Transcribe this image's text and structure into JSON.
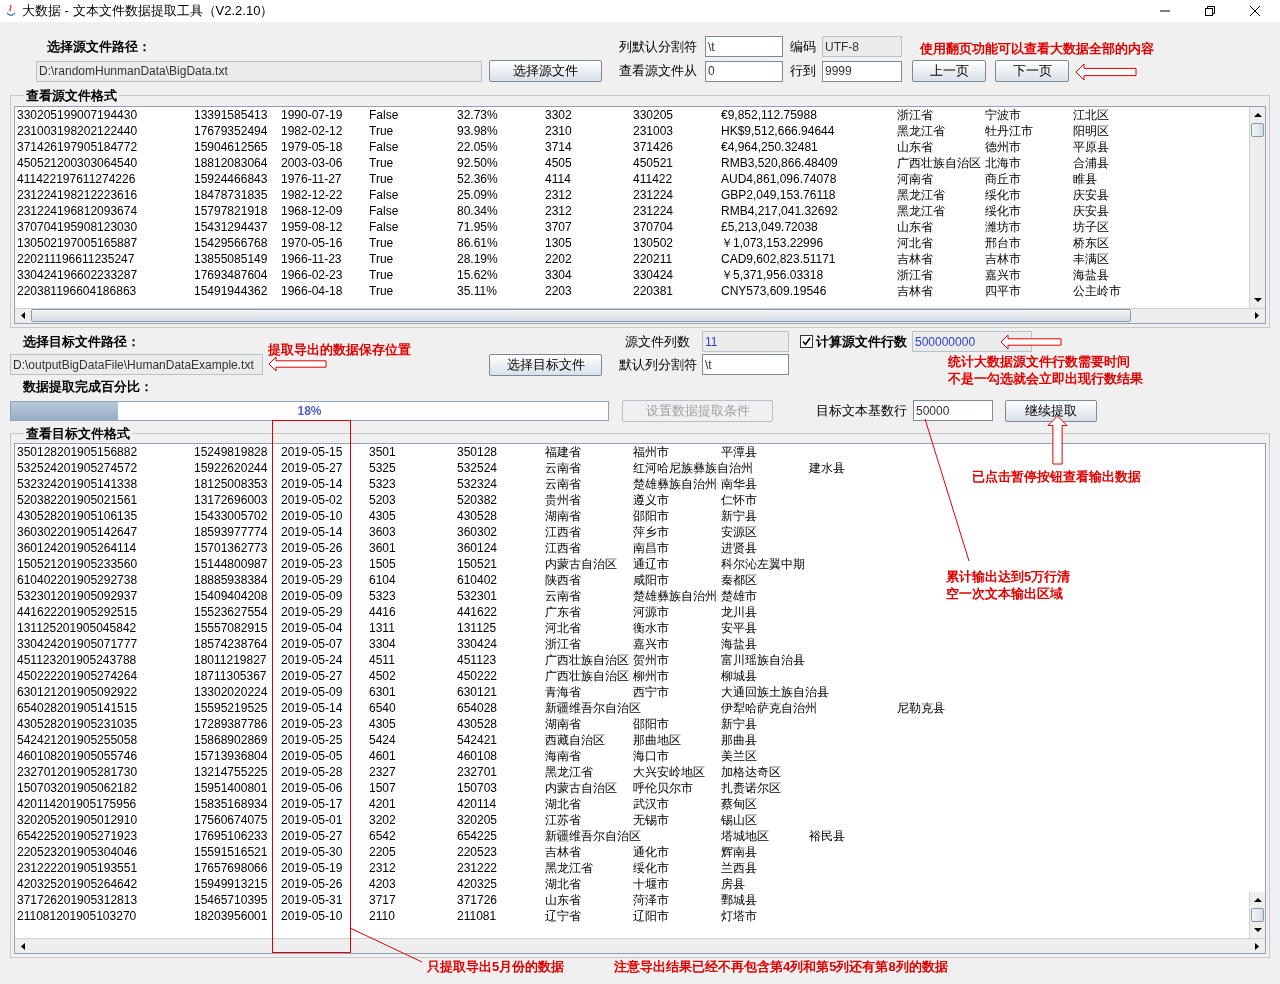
{
  "window": {
    "title": "大数据 - 文本文件数据提取工具（V2.2.10）"
  },
  "source": {
    "path_label": "选择源文件路径：",
    "path": {
      "value": "D:\\randomHunmanData\\BigData.txt",
      "readonly": true
    },
    "choose_button": "选择源文件",
    "delimiter_label": "列默认分割符",
    "delimiter": {
      "value": "\\t",
      "readonly": false
    },
    "encoding_label": "编码",
    "encoding": {
      "value": "UTF-8",
      "readonly": true
    },
    "from_label": "查看源文件从",
    "from": {
      "value": "0",
      "readonly": false
    },
    "to_label": "行到",
    "to": {
      "value": "9999",
      "readonly": false
    },
    "prev_button": "上一页",
    "next_button": "下一页"
  },
  "source_table": {
    "title": "查看源文件格式",
    "rows": [
      [
        "330205199007194430",
        "13391585413",
        "1990-07-19",
        "False",
        "32.73%",
        "3302",
        "330205",
        "€9,852,112.75988",
        "浙江省",
        "宁波市",
        "江北区"
      ],
      [
        "231003198202122440",
        "17679352494",
        "1982-02-12",
        "True",
        "93.98%",
        "2310",
        "231003",
        "HK$9,512,666.94644",
        "黑龙江省",
        "牡丹江市",
        "阳明区"
      ],
      [
        "371426197905184772",
        "15904612565",
        "1979-05-18",
        "False",
        "22.05%",
        "3714",
        "371426",
        "€4,964,250.32481",
        "山东省",
        "德州市",
        "平原县"
      ],
      [
        "450521200303064540",
        "18812083064",
        "2003-03-06",
        "True",
        "92.50%",
        "4505",
        "450521",
        "RMB3,520,866.48409",
        "广西壮族自治区",
        "北海市",
        "合浦县"
      ],
      [
        "411422197611274226",
        "15924466843",
        "1976-11-27",
        "True",
        "52.36%",
        "4114",
        "411422",
        "AUD4,861,096.74078",
        "河南省",
        "商丘市",
        "睢县"
      ],
      [
        "231224198212223616",
        "18478731835",
        "1982-12-22",
        "False",
        "25.09%",
        "2312",
        "231224",
        "GBP2,049,153.76118",
        "黑龙江省",
        "绥化市",
        "庆安县"
      ],
      [
        "231224196812093674",
        "15797821918",
        "1968-12-09",
        "False",
        "80.34%",
        "2312",
        "231224",
        "RMB4,217,041.32692",
        "黑龙江省",
        "绥化市",
        "庆安县"
      ],
      [
        "370704195908123030",
        "15431294437",
        "1959-08-12",
        "False",
        "71.95%",
        "3707",
        "370704",
        "£5,213,049.72038",
        "山东省",
        "潍坊市",
        "坊子区"
      ],
      [
        "130502197005165887",
        "15429566768",
        "1970-05-16",
        "True",
        "86.61%",
        "1305",
        "130502",
        "￥1,073,153.22996",
        "河北省",
        "邢台市",
        "桥东区"
      ],
      [
        "220211196611235247",
        "13855085149",
        "1966-11-23",
        "True",
        "28.19%",
        "2202",
        "220211",
        "CAD9,602,823.51171",
        "吉林省",
        "吉林市",
        "丰满区"
      ],
      [
        "330424196602233287",
        "17693487604",
        "1966-02-23",
        "True",
        "15.62%",
        "3304",
        "330424",
        "￥5,371,956.03318",
        "浙江省",
        "嘉兴市",
        "海盐县"
      ],
      [
        "220381196604186863",
        "15491944362",
        "1966-04-18",
        "True",
        "35.11%",
        "2203",
        "220381",
        "CNY573,609.19546",
        "吉林省",
        "四平市",
        "公主岭市"
      ]
    ]
  },
  "target": {
    "path_label": "选择目标文件路径：",
    "path": {
      "value": "D:\\outputBigDataFile\\HumanDataExample.txt",
      "readonly": true
    },
    "choose_button": "选择目标文件",
    "columns_label": "源文件列数",
    "columns": {
      "value": "11",
      "readonly": true
    },
    "count_rows": {
      "label": "计算源文件行数",
      "checked": true
    },
    "row_count": {
      "value": "500000000",
      "readonly": true
    },
    "delimiter_label": "默认列分割符",
    "delimiter": {
      "value": "\\t",
      "readonly": false
    },
    "progress_label": "数据提取完成百分比：",
    "progress": {
      "level": 0.18,
      "text": "18%"
    },
    "conditions_button": {
      "label": "设置数据提取条件",
      "disabled": true
    },
    "base_rows_label": "目标文本基数行",
    "base_rows": {
      "value": "50000",
      "readonly": false
    },
    "continue_button": {
      "label": "继续提取",
      "disabled": false
    }
  },
  "target_table": {
    "title": "查看目标文件格式",
    "rows": [
      {
        "c1": "350128201905156882",
        "c2": "15249819828",
        "c3": "2019-05-15",
        "c4": "3501",
        "c5": "350128",
        "c6": "福建省",
        "c7": "福州市",
        "c8": "平潭县"
      },
      {
        "c1": "532524201905274572",
        "c2": "15922620244",
        "c3": "2019-05-27",
        "c4": "5325",
        "c5": "532524",
        "c6": "云南省",
        "c7": "红河哈尼族彝族自治州",
        "c9": "建水县"
      },
      {
        "c1": "532324201905141338",
        "c2": "18125008353",
        "c3": "2019-05-14",
        "c4": "5323",
        "c5": "532324",
        "c6": "云南省",
        "c7": "楚雄彝族自治州",
        "c8": "南华县"
      },
      {
        "c1": "520382201905021561",
        "c2": "13172696003",
        "c3": "2019-05-02",
        "c4": "5203",
        "c5": "520382",
        "c6": "贵州省",
        "c7": "遵义市",
        "c8": "仁怀市"
      },
      {
        "c1": "430528201905106135",
        "c2": "15433005702",
        "c3": "2019-05-10",
        "c4": "4305",
        "c5": "430528",
        "c6": "湖南省",
        "c7": "邵阳市",
        "c8": "新宁县"
      },
      {
        "c1": "360302201905142647",
        "c2": "18593977774",
        "c3": "2019-05-14",
        "c4": "3603",
        "c5": "360302",
        "c6": "江西省",
        "c7": "萍乡市",
        "c8": "安源区"
      },
      {
        "c1": "360124201905264114",
        "c2": "15701362773",
        "c3": "2019-05-26",
        "c4": "3601",
        "c5": "360124",
        "c6": "江西省",
        "c7": "南昌市",
        "c8": "进贤县"
      },
      {
        "c1": "150521201905233560",
        "c2": "15144800987",
        "c3": "2019-05-23",
        "c4": "1505",
        "c5": "150521",
        "c6": "内蒙古自治区",
        "c7": "通辽市",
        "c8": "科尔沁左翼中期"
      },
      {
        "c1": "610402201905292738",
        "c2": "18885938384",
        "c3": "2019-05-29",
        "c4": "6104",
        "c5": "610402",
        "c6": "陕西省",
        "c7": "咸阳市",
        "c8": "秦都区"
      },
      {
        "c1": "532301201905092937",
        "c2": "15409404208",
        "c3": "2019-05-09",
        "c4": "5323",
        "c5": "532301",
        "c6": "云南省",
        "c7": "楚雄彝族自治州",
        "c8": "楚雄市"
      },
      {
        "c1": "441622201905292515",
        "c2": "15523627554",
        "c3": "2019-05-29",
        "c4": "4416",
        "c5": "441622",
        "c6": "广东省",
        "c7": "河源市",
        "c8": "龙川县"
      },
      {
        "c1": "131125201905045842",
        "c2": "15557082915",
        "c3": "2019-05-04",
        "c4": "1311",
        "c5": "131125",
        "c6": "河北省",
        "c7": "衡水市",
        "c8": "安平县"
      },
      {
        "c1": "330424201905071777",
        "c2": "18574238764",
        "c3": "2019-05-07",
        "c4": "3304",
        "c5": "330424",
        "c6": "浙江省",
        "c7": "嘉兴市",
        "c8": "海盐县"
      },
      {
        "c1": "451123201905243788",
        "c2": "18011219827",
        "c3": "2019-05-24",
        "c4": "4511",
        "c5": "451123",
        "c6": "广西壮族自治区",
        "c7": "贺州市",
        "c8": "富川瑶族自治县"
      },
      {
        "c1": "450222201905274264",
        "c2": "18711305367",
        "c3": "2019-05-27",
        "c4": "4502",
        "c5": "450222",
        "c6": "广西壮族自治区",
        "c7": "柳州市",
        "c8": "柳城县"
      },
      {
        "c1": "630121201905092922",
        "c2": "13302020224",
        "c3": "2019-05-09",
        "c4": "6301",
        "c5": "630121",
        "c6": "青海省",
        "c7": "西宁市",
        "c8": "大通回族土族自治县"
      },
      {
        "c1": "654028201905141515",
        "c2": "15595219525",
        "c3": "2019-05-14",
        "c4": "6540",
        "c5": "654028",
        "c6": "新疆维吾尔自治区",
        "c8": "伊犁哈萨克自治州",
        "c10": "尼勒克县"
      },
      {
        "c1": "430528201905231035",
        "c2": "17289387786",
        "c3": "2019-05-23",
        "c4": "4305",
        "c5": "430528",
        "c6": "湖南省",
        "c7": "邵阳市",
        "c8": "新宁县"
      },
      {
        "c1": "542421201905255058",
        "c2": "15868902869",
        "c3": "2019-05-25",
        "c4": "5424",
        "c5": "542421",
        "c6": "西藏自治区",
        "c7": "那曲地区",
        "c8": "那曲县"
      },
      {
        "c1": "460108201905055746",
        "c2": "15713936804",
        "c3": "2019-05-05",
        "c4": "4601",
        "c5": "460108",
        "c6": "海南省",
        "c7": "海口市",
        "c8": "美兰区"
      },
      {
        "c1": "232701201905281730",
        "c2": "13214755225",
        "c3": "2019-05-28",
        "c4": "2327",
        "c5": "232701",
        "c6": "黑龙江省",
        "c7": "大兴安岭地区",
        "c8": "加格达奇区"
      },
      {
        "c1": "150703201905062182",
        "c2": "15951400801",
        "c3": "2019-05-06",
        "c4": "1507",
        "c5": "150703",
        "c6": "内蒙古自治区",
        "c7": "呼伦贝尔市",
        "c8": "扎赉诺尔区"
      },
      {
        "c1": "420114201905175956",
        "c2": "15835168934",
        "c3": "2019-05-17",
        "c4": "4201",
        "c5": "420114",
        "c6": "湖北省",
        "c7": "武汉市",
        "c8": "蔡甸区"
      },
      {
        "c1": "320205201905012910",
        "c2": "17560674075",
        "c3": "2019-05-01",
        "c4": "3202",
        "c5": "320205",
        "c6": "江苏省",
        "c7": "无锡市",
        "c8": "锡山区"
      },
      {
        "c1": "654225201905271923",
        "c2": "17695106233",
        "c3": "2019-05-27",
        "c4": "6542",
        "c5": "654225",
        "c6": "新疆维吾尔自治区",
        "c8": "塔城地区",
        "c9": "裕民县"
      },
      {
        "c1": "220523201905304046",
        "c2": "15591516521",
        "c3": "2019-05-30",
        "c4": "2205",
        "c5": "220523",
        "c6": "吉林省",
        "c7": "通化市",
        "c8": "辉南县"
      },
      {
        "c1": "231222201905193551",
        "c2": "17657698066",
        "c3": "2019-05-19",
        "c4": "2312",
        "c5": "231222",
        "c6": "黑龙江省",
        "c7": "绥化市",
        "c8": "兰西县"
      },
      {
        "c1": "420325201905264642",
        "c2": "15949913215",
        "c3": "2019-05-26",
        "c4": "4203",
        "c5": "420325",
        "c6": "湖北省",
        "c7": "十堰市",
        "c8": "房县"
      },
      {
        "c1": "371726201905312813",
        "c2": "15465710395",
        "c3": "2019-05-31",
        "c4": "3717",
        "c5": "371726",
        "c6": "山东省",
        "c7": "菏泽市",
        "c8": "鄄城县"
      },
      {
        "c1": "211081201905103270",
        "c2": "18203956001",
        "c3": "2019-05-10",
        "c4": "2110",
        "c5": "211081",
        "c6": "辽宁省",
        "c7": "辽阳市",
        "c8": "灯塔市"
      }
    ]
  },
  "annotations": [
    {
      "text": "使用翻页功能可以查看大数据全部的内容"
    },
    {
      "text": "提取导出的数据保存位置"
    },
    {
      "text": "统计大数据源文件行数需要时间"
    },
    {
      "text": "不是一勾选就会立即出现行数结果"
    },
    {
      "text": "已点击暂停按钮查看输出数据"
    },
    {
      "text": "累计输出达到5万行清"
    },
    {
      "text": "空一次文本输出区域"
    },
    {
      "text": "只提取导出5月份的数据"
    },
    {
      "text": "注意导出结果已经不再包含第4列和第5列还有第8列的数据"
    }
  ]
}
